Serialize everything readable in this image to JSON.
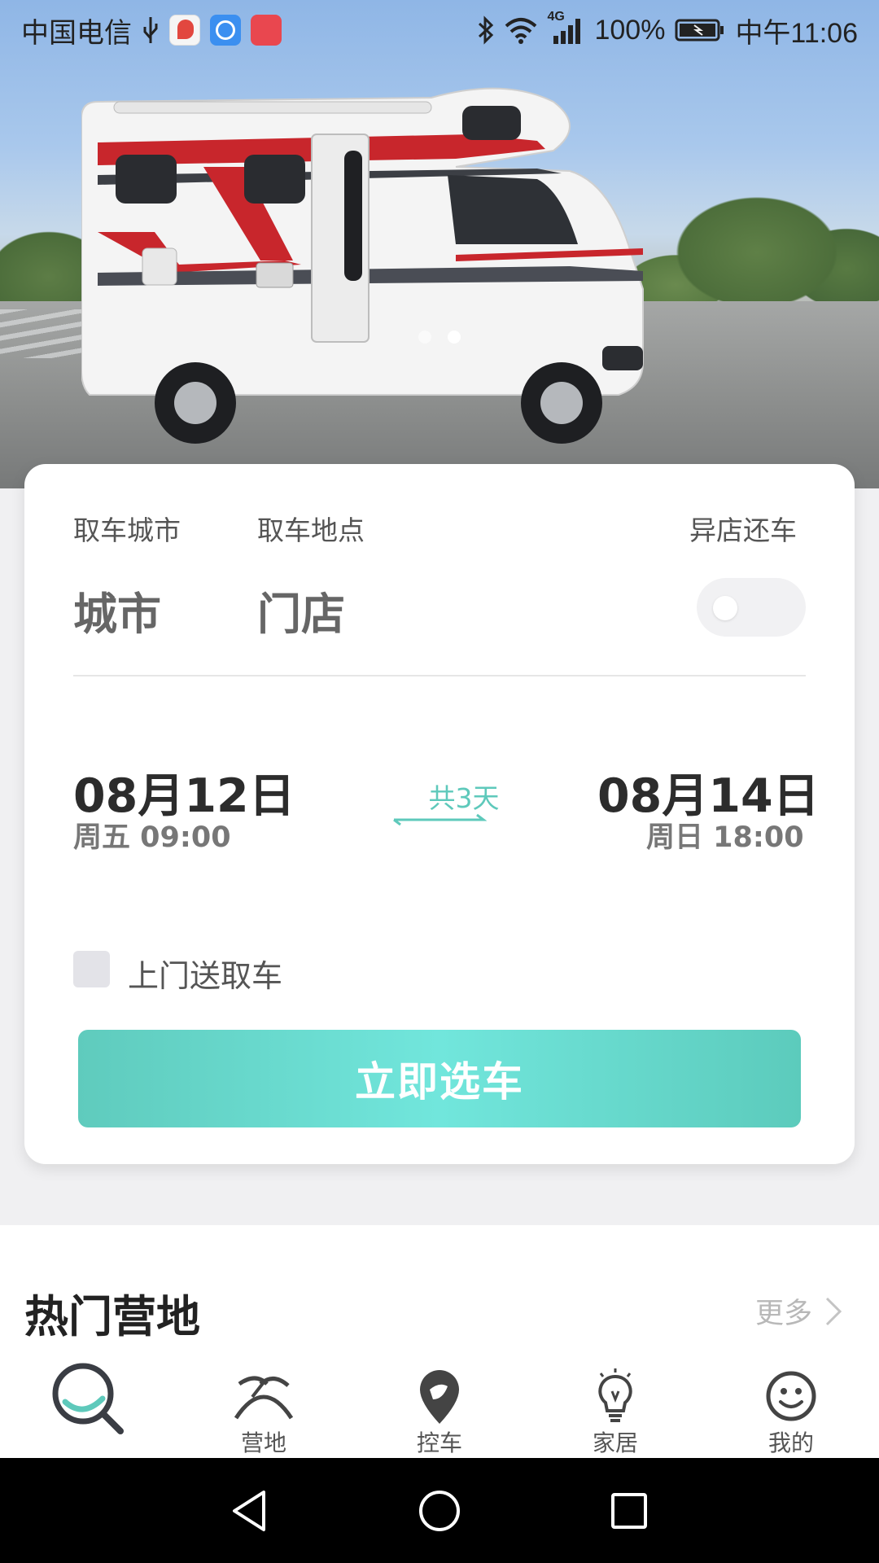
{
  "status_bar": {
    "carrier": "中国电信",
    "signal_type": "4G",
    "battery": "100%",
    "time": "中午11:06"
  },
  "hero": {
    "slides_total": 2,
    "active_slide": 2
  },
  "booking": {
    "pickup_city_label": "取车城市",
    "pickup_city_value": "城市",
    "pickup_location_label": "取车地点",
    "pickup_location_value": "门店",
    "different_return_label": "异店还车",
    "different_return_enabled": false,
    "start_date": "08月12日",
    "start_time": "周五 09:00",
    "duration": "共3天",
    "end_date": "08月14日",
    "end_time": "周日 18:00",
    "delivery_label": "上门送取车",
    "delivery_checked": false,
    "submit_label": "立即选车"
  },
  "popular_camps": {
    "title": "热门营地",
    "more_label": "更多"
  },
  "tabbar": {
    "items": [
      {
        "icon": "search-icon",
        "label": "",
        "active": true
      },
      {
        "icon": "camp-icon",
        "label": "营地"
      },
      {
        "icon": "car-control-icon",
        "label": "控车"
      },
      {
        "icon": "lightbulb-icon",
        "label": "家居"
      },
      {
        "icon": "smiley-icon",
        "label": "我的"
      }
    ]
  },
  "colors": {
    "accent": "#5ec9bb",
    "button_gradient_mid": "#71e6dc",
    "background": "#f0f0f2"
  }
}
